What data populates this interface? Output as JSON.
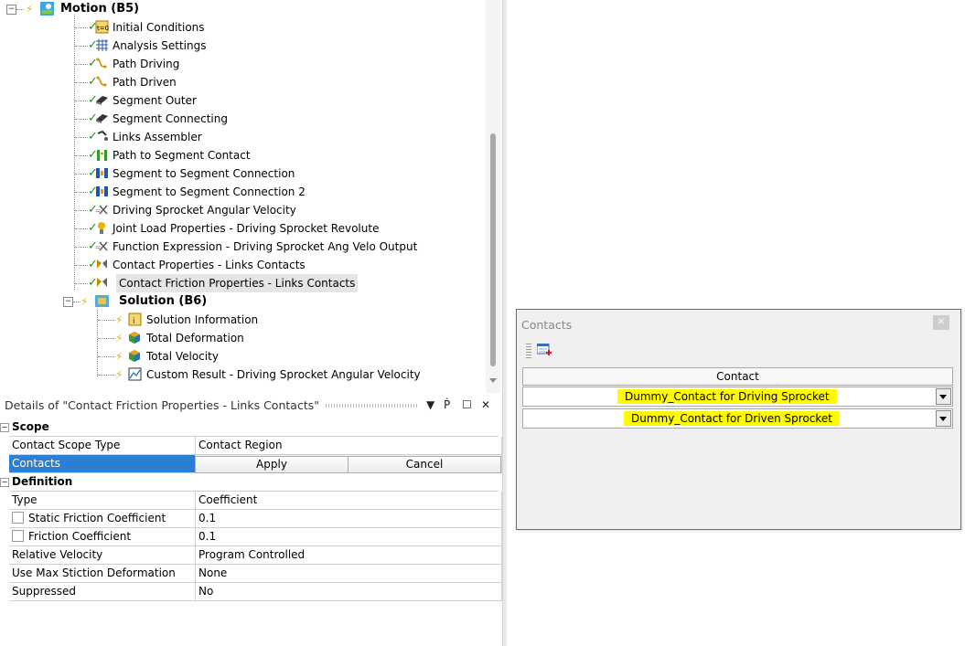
{
  "tree": {
    "motion": {
      "label": "Motion (B5)"
    },
    "items": [
      "Initial Conditions",
      "Analysis Settings",
      "Path Driving",
      "Path Driven",
      "Segment Outer",
      "Segment Connecting",
      "Links Assembler",
      "Path to Segment Contact",
      "Segment to Segment Connection",
      "Segment to Segment Connection 2",
      "Driving Sprocket Angular Velocity",
      "Joint Load Properties - Driving Sprocket Revolute",
      "Function Expression - Driving Sprocket Ang Velo Output",
      "Contact Properties - Links Contacts",
      "Contact Friction Properties - Links Contacts"
    ],
    "solution": {
      "label": "Solution (B6)"
    },
    "solution_items": [
      "Solution Information",
      "Total Deformation",
      "Total Velocity",
      "Custom Result - Driving Sprocket Angular Velocity"
    ]
  },
  "details": {
    "title": "Details of \"Contact Friction Properties - Links Contacts\"",
    "scope": {
      "section": "Scope",
      "contact_scope_type_label": "Contact Scope Type",
      "contact_scope_type_value": "Contact Region",
      "contacts_label": "Contacts",
      "apply": "Apply",
      "cancel": "Cancel"
    },
    "definition": {
      "section": "Definition",
      "type_label": "Type",
      "type_value": "Coefficient",
      "static_friction_label": "Static Friction Coefficient",
      "static_friction_value": "0.1",
      "friction_label": "Friction Coefficient",
      "friction_value": "0.1",
      "relative_velocity_label": "Relative Velocity",
      "relative_velocity_value": "Program Controlled",
      "max_stiction_label": "Use Max Stiction Deformation",
      "max_stiction_value": "None",
      "suppressed_label": "Suppressed",
      "suppressed_value": "No"
    }
  },
  "contacts_dialog": {
    "title": "Contacts",
    "column_header": "Contact",
    "rows": [
      "Dummy_Contact for Driving Sprocket",
      "Dummy_Contact for Driven Sprocket"
    ]
  },
  "colors": {
    "selection_blue": "#2a7ed3",
    "highlight_yellow": "#fffa00",
    "check_green": "#1a9c1a"
  }
}
